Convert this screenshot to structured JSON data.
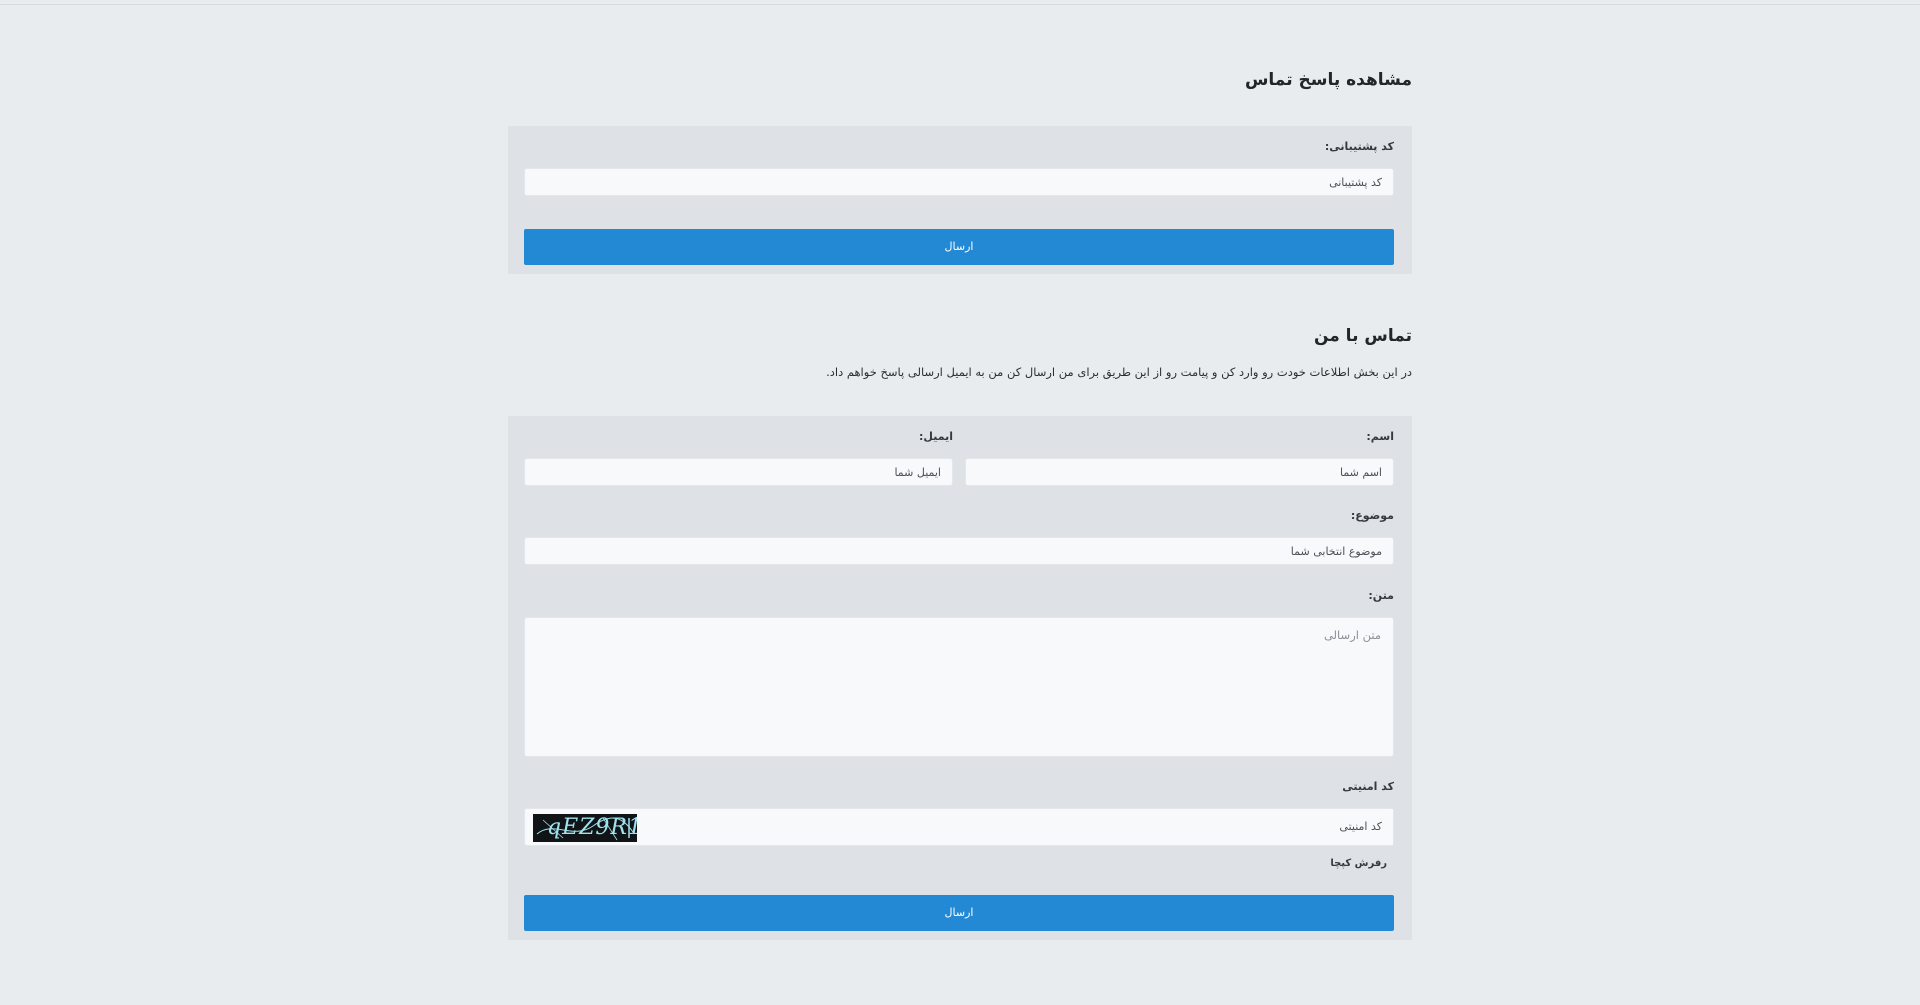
{
  "tracking": {
    "title": "مشاهده پاسخ تماس",
    "code_label": "کد پشتیبانی:",
    "code_placeholder": "کد  پشتیبانی",
    "submit_label": "ارسال"
  },
  "contact": {
    "title": "تماس با من",
    "description": "در این بخش اطلاعات خودت رو وارد کن و پیامت رو از این طریق برای من ارسال کن من به ایمیل ارسالی پاسخ خواهم داد.",
    "name_label": "اسم:",
    "name_placeholder": "اسم  شما",
    "email_label": "ایمیل:",
    "email_placeholder": "ایمیل  شما",
    "subject_label": "موضوع:",
    "subject_placeholder": "موضوع  انتخابی  شما",
    "message_label": "متن:",
    "message_placeholder": "متن ارسالی",
    "captcha_label": "کد امنیتی",
    "captcha_placeholder": "کد  امنیتی",
    "captcha_image_text": "qEZ9R1",
    "refresh_label": "رفرش کپچا",
    "submit_label": "ارسال"
  },
  "colors": {
    "page_background": "#e9ecef",
    "card_background": "#dee1e6",
    "input_background": "#f8f9fa",
    "button_primary": "#2389d4"
  }
}
